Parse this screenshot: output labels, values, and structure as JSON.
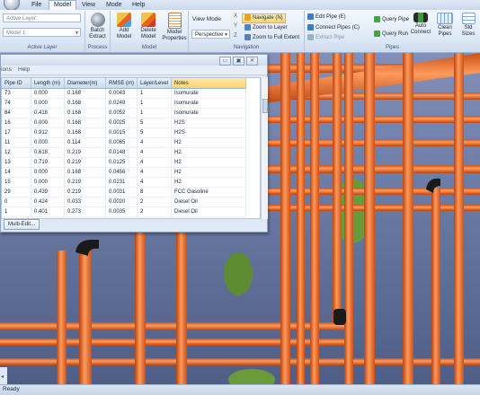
{
  "menu": {
    "tabs": [
      "File",
      "Model",
      "View",
      "Mode",
      "Help"
    ],
    "active_tab": "Model"
  },
  "ribbon": {
    "active_layer": {
      "label": "Active Layer:",
      "value": "Model 1",
      "group_label": "Active Layer"
    },
    "process": {
      "batch_extract": "Batch\nExtract",
      "group_label": "Process"
    },
    "model": {
      "add_model": "Add\nModel",
      "delete_model": "Delete\nModel",
      "model_properties": "Model\nProperties",
      "group_label": "Model"
    },
    "navigation": {
      "view_mode_label": "View Mode",
      "view_mode_value": "Perspective",
      "axes": [
        "X",
        "Y",
        "Z"
      ],
      "navigate": "Navigate (N)",
      "zoom_to_layer": "Zoom to Layer",
      "zoom_to_full_extent": "Zoom to Full Extent",
      "group_label": "Navigation"
    },
    "pipes": {
      "edit_pipe": "Edit Pipe (E)",
      "connect_pipes": "Connect Pipes (C)",
      "extract_pipe": "Extract Pipe",
      "query_pipe": "Query Pipe",
      "query_run": "Query Run",
      "auto_connect": "Auto\nConnect",
      "clean_pipes": "Clean\nPipes",
      "std_sizes": "Std\nSizes",
      "group_label": "Pipes"
    }
  },
  "table_window": {
    "menu": [
      "ions",
      "Help"
    ],
    "columns": [
      "Pipe ID",
      "Length (m)",
      "Diameter(m)",
      "RMSE (m)",
      "Layer/Level",
      "Notes"
    ],
    "rows": [
      [
        "73",
        "0.000",
        "0.168",
        "0.0043",
        "1",
        "Isomurate"
      ],
      [
        "74",
        "0.000",
        "0.168",
        "0.0249",
        "1",
        "Isomurate"
      ],
      [
        "84",
        "0.418",
        "0.168",
        "0.0052",
        "1",
        "Isomurate"
      ],
      [
        "16",
        "0.000",
        "0.168",
        "0.0025",
        "5",
        "H2S"
      ],
      [
        "17",
        "0.912",
        "0.168",
        "0.0015",
        "5",
        "H2S"
      ],
      [
        "11",
        "0.000",
        "0.114",
        "0.0065",
        "4",
        "H2"
      ],
      [
        "12",
        "0.618",
        "0.219",
        "0.0148",
        "4",
        "H2"
      ],
      [
        "13",
        "0.719",
        "0.219",
        "0.0125",
        "4",
        "H2"
      ],
      [
        "14",
        "0.000",
        "0.168",
        "0.0456",
        "4",
        "H2"
      ],
      [
        "15",
        "0.000",
        "0.219",
        "0.0231",
        "4",
        "H2"
      ],
      [
        "29",
        "0.439",
        "0.219",
        "0.0031",
        "8",
        "FCC Gasoline"
      ],
      [
        "0",
        "0.424",
        "0.033",
        "0.0020",
        "2",
        "Diesel Oil"
      ],
      [
        "1",
        "0.401",
        "0.273",
        "0.0035",
        "2",
        "Diesel Oil"
      ]
    ],
    "multi_edit_label": "Multi-Edit..."
  },
  "status": {
    "text": "Ready"
  },
  "colors": {
    "pipe_orange": "#e8641e",
    "pipe_highlight": "#ffb07a",
    "ribbon_blue": "#dde8f5",
    "viewport_sky": "#8f9dc3",
    "vegetation_green": "#6a9a3a"
  }
}
